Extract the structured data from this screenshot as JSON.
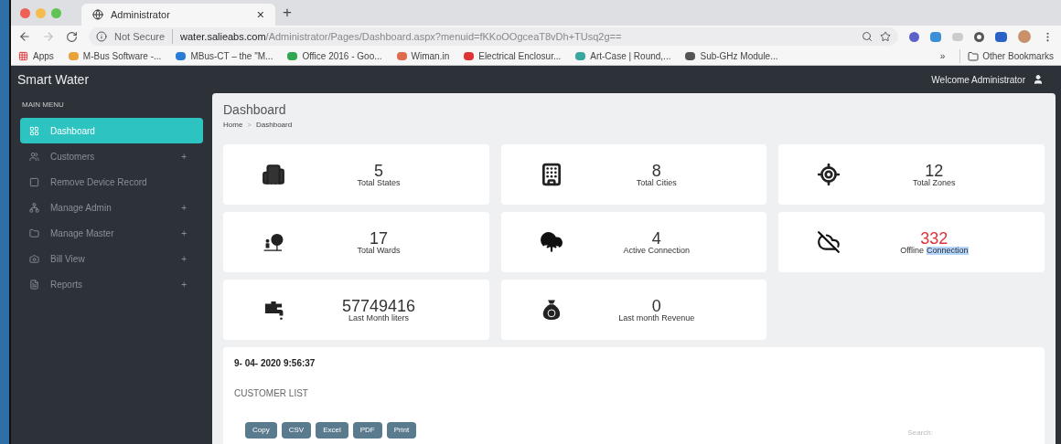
{
  "browser": {
    "tab": {
      "title": "Administrator",
      "close": "×"
    },
    "new_tab": "+",
    "security": "Not Secure",
    "url_domain": "water.salieabs.com",
    "url_path": "/Administrator/Pages/Dashboard.aspx?menuid=fKKoOOgceaT8vDh+TUsq2g==",
    "bookmarks": [
      {
        "label": "Apps"
      },
      {
        "label": "M-Bus Software -..."
      },
      {
        "label": "MBus-CT – the \"M..."
      },
      {
        "label": "Office 2016 - Goo..."
      },
      {
        "label": "Wiman.in"
      },
      {
        "label": "Electrical Enclosur..."
      },
      {
        "label": "Art-Case | Round,..."
      },
      {
        "label": "Sub-GHz Module..."
      }
    ],
    "more": "»",
    "other_bookmarks": "Other Bookmarks"
  },
  "app": {
    "title": "Smart Water",
    "welcome": "Welcome Administrator"
  },
  "sidebar": {
    "heading": "MAIN MENU",
    "items": [
      {
        "label": "Dashboard",
        "selected": true
      },
      {
        "label": "Customers",
        "selected": false,
        "toggle": "+"
      },
      {
        "label": "Remove Device Record",
        "selected": false
      },
      {
        "label": "Manage Admin",
        "selected": false,
        "toggle": "+"
      },
      {
        "label": "Manage Master",
        "selected": false,
        "toggle": "+"
      },
      {
        "label": "Bill View",
        "selected": false,
        "toggle": "+"
      },
      {
        "label": "Reports",
        "selected": false,
        "toggle": "+"
      }
    ]
  },
  "page": {
    "title": "Dashboard",
    "breadcrumb": [
      "Home",
      "Dashboard"
    ],
    "separator": ">"
  },
  "stats": [
    {
      "value": "5",
      "label": "Total States",
      "alert": false
    },
    {
      "value": "8",
      "label": "Total Cities",
      "alert": false
    },
    {
      "value": "12",
      "label": "Total Zones",
      "alert": false
    },
    {
      "value": "17",
      "label": "Total Wards",
      "alert": false
    },
    {
      "value": "4",
      "label": "Active Connection",
      "alert": false
    },
    {
      "value": "332",
      "label_parts": [
        {
          "text": "Offline",
          "selected": false
        },
        {
          "text": "Connection",
          "selected": true
        }
      ],
      "alert": true
    },
    {
      "value": "57749416",
      "label": "Last Month liters",
      "alert": false
    },
    {
      "value": "0",
      "label": "Last month Revenue",
      "alert": false
    }
  ],
  "customer_panel": {
    "timestamp": "9- 04- 2020 9:56:37",
    "title": "CUSTOMER LIST",
    "buttons": [
      "Copy",
      "CSV",
      "Excel",
      "PDF",
      "Print"
    ],
    "search_label": "Search:"
  }
}
